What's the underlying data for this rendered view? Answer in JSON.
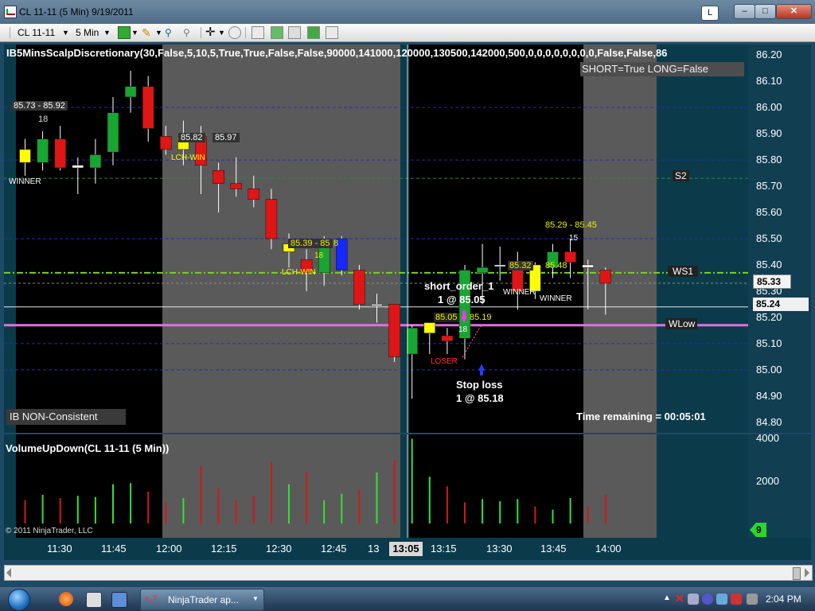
{
  "window": {
    "title": "CL 11-11 (5 Min)  9/19/2011",
    "l_button": "L",
    "min_glyph": "–",
    "max_glyph": "□",
    "close_glyph": "✕"
  },
  "toolbar": {
    "instrument": "CL 11-11",
    "interval": "5 Min"
  },
  "chart": {
    "indicator_header": "IB5MinsScalpDiscretionary(30,False,5,10,5,True,True,False,False,90000,141000,120000,130500,142000,500,0,0,0,0,0,0,0,0,False,False,86",
    "short_long_text": "SHORT=True LONG=False",
    "ib_text": "IB NON-Consistent",
    "time_remaining": "Time remaining = 00:05:01",
    "copyright": "© 2011 NinjaTrader, LLC",
    "volume_title": "VolumeUpDown(CL 11-11 (5 Min))",
    "price_labels": {
      "last": "85.33",
      "line": "85.24"
    },
    "level_labels": {
      "s2": "S2",
      "ws1": "WS1",
      "wlow": "WLow"
    },
    "annotations": {
      "range1": "85.73 - 85.92",
      "n1": "18",
      "winner1": "WINNER",
      "range2_a": "85.82",
      "range2_b": "85.97",
      "lch1": "LCH-WIN",
      "range3_a": "85.39 - 85",
      "range3_b": "8",
      "n3": "18",
      "lch2": "LCH-WIN",
      "short_order": "short_order_1",
      "short_price": "1 @ 85.05",
      "range4_a": "85.05",
      "range4_b": "85.19",
      "n4": "18",
      "loser": "LOSER",
      "stop_loss": "Stop loss",
      "stop_price": "1 @ 85.18",
      "range5_a": "85.32",
      "range5_b": "85.48",
      "winner2": "WINNER",
      "winner3": "WINNER",
      "range6": "85.29 - 85.45",
      "n6": "15"
    },
    "time_marker": "13:05",
    "volume_badge": "9"
  },
  "chart_data": {
    "type": "candlestick",
    "x_ticks": [
      "11:30",
      "11:45",
      "12:00",
      "12:15",
      "12:30",
      "12:45",
      "13",
      "13:15",
      "13:30",
      "13:45",
      "14:00"
    ],
    "y_ticks": [
      "86.20",
      "86.10",
      "86.00",
      "85.90",
      "85.80",
      "85.70",
      "85.60",
      "85.50",
      "85.40",
      "85.30",
      "85.20",
      "85.10",
      "85.00",
      "84.90",
      "84.80"
    ],
    "ylim": [
      84.76,
      86.24
    ],
    "volume_ticks": [
      "4000",
      "2000"
    ],
    "volume_ylim": [
      0,
      4200
    ],
    "candles": [
      {
        "o": 85.84,
        "h": 85.88,
        "l": 85.74,
        "c": 85.79,
        "color": "yellow"
      },
      {
        "o": 85.79,
        "h": 85.91,
        "l": 85.76,
        "c": 85.88,
        "color": "green"
      },
      {
        "o": 85.88,
        "h": 85.93,
        "l": 85.76,
        "c": 85.77,
        "color": "red"
      },
      {
        "o": 85.78,
        "h": 85.81,
        "l": 85.67,
        "c": 85.77,
        "color": "white"
      },
      {
        "o": 85.77,
        "h": 85.88,
        "l": 85.71,
        "c": 85.82,
        "color": "green"
      },
      {
        "o": 85.83,
        "h": 86.04,
        "l": 85.78,
        "c": 85.98,
        "color": "green"
      },
      {
        "o": 86.04,
        "h": 86.14,
        "l": 85.98,
        "c": 86.08,
        "color": "green"
      },
      {
        "o": 86.08,
        "h": 86.12,
        "l": 85.87,
        "c": 85.92,
        "color": "red"
      },
      {
        "o": 85.89,
        "h": 85.93,
        "l": 85.82,
        "c": 85.84,
        "color": "red"
      },
      {
        "o": 85.84,
        "h": 85.95,
        "l": 85.78,
        "c": 85.89,
        "color": "yellow"
      },
      {
        "o": 85.89,
        "h": 85.93,
        "l": 85.67,
        "c": 85.78,
        "color": "red"
      },
      {
        "o": 85.76,
        "h": 85.79,
        "l": 85.6,
        "c": 85.71,
        "color": "red"
      },
      {
        "o": 85.71,
        "h": 85.81,
        "l": 85.66,
        "c": 85.69,
        "color": "red"
      },
      {
        "o": 85.69,
        "h": 85.74,
        "l": 85.62,
        "c": 85.65,
        "color": "red"
      },
      {
        "o": 85.65,
        "h": 85.69,
        "l": 85.46,
        "c": 85.5,
        "color": "red"
      },
      {
        "o": 85.48,
        "h": 85.52,
        "l": 85.39,
        "c": 85.45,
        "color": "yellow"
      },
      {
        "o": 85.42,
        "h": 85.46,
        "l": 85.3,
        "c": 85.37,
        "color": "red"
      },
      {
        "o": 85.37,
        "h": 85.51,
        "l": 85.32,
        "c": 85.49,
        "color": "green"
      },
      {
        "o": 85.5,
        "h": 85.51,
        "l": 85.36,
        "c": 85.38,
        "color": "blue"
      },
      {
        "o": 85.38,
        "h": 85.4,
        "l": 85.23,
        "c": 85.25,
        "color": "red"
      },
      {
        "o": 85.25,
        "h": 85.29,
        "l": 85.18,
        "c": 85.25,
        "color": "white"
      },
      {
        "o": 85.25,
        "h": 85.25,
        "l": 85.03,
        "c": 85.05,
        "color": "red"
      },
      {
        "o": 85.06,
        "h": 85.17,
        "l": 84.89,
        "c": 85.16,
        "color": "green"
      },
      {
        "o": 85.14,
        "h": 85.18,
        "l": 85.06,
        "c": 85.18,
        "color": "yellow"
      },
      {
        "o": 85.13,
        "h": 85.16,
        "l": 85.06,
        "c": 85.11,
        "color": "red"
      },
      {
        "o": 85.12,
        "h": 85.4,
        "l": 85.04,
        "c": 85.38,
        "color": "green"
      },
      {
        "o": 85.37,
        "h": 85.48,
        "l": 85.25,
        "c": 85.39,
        "color": "green"
      },
      {
        "o": 85.4,
        "h": 85.47,
        "l": 85.34,
        "c": 85.4,
        "color": "white"
      },
      {
        "o": 85.41,
        "h": 85.45,
        "l": 85.23,
        "c": 85.3,
        "color": "red"
      },
      {
        "o": 85.3,
        "h": 85.41,
        "l": 85.27,
        "c": 85.4,
        "color": "yellow"
      },
      {
        "o": 85.39,
        "h": 85.48,
        "l": 85.35,
        "c": 85.45,
        "color": "green"
      },
      {
        "o": 85.45,
        "h": 85.5,
        "l": 85.35,
        "c": 85.41,
        "color": "red"
      },
      {
        "o": 85.4,
        "h": 85.42,
        "l": 85.23,
        "c": 85.39,
        "color": "white"
      },
      {
        "o": 85.38,
        "h": 85.39,
        "l": 85.21,
        "c": 85.33,
        "color": "red"
      }
    ],
    "volumes": [
      {
        "v": 1100,
        "d": "down"
      },
      {
        "v": 1350,
        "d": "up"
      },
      {
        "v": 1200,
        "d": "down"
      },
      {
        "v": 1300,
        "d": "up"
      },
      {
        "v": 1250,
        "d": "up"
      },
      {
        "v": 1850,
        "d": "up"
      },
      {
        "v": 1900,
        "d": "up"
      },
      {
        "v": 1500,
        "d": "down"
      },
      {
        "v": 1000,
        "d": "down"
      },
      {
        "v": 1200,
        "d": "up"
      },
      {
        "v": 2700,
        "d": "down"
      },
      {
        "v": 1650,
        "d": "down"
      },
      {
        "v": 1100,
        "d": "down"
      },
      {
        "v": 1300,
        "d": "down"
      },
      {
        "v": 2900,
        "d": "down"
      },
      {
        "v": 1850,
        "d": "up"
      },
      {
        "v": 2450,
        "d": "down"
      },
      {
        "v": 1100,
        "d": "up"
      },
      {
        "v": 1400,
        "d": "up"
      },
      {
        "v": 1600,
        "d": "down"
      },
      {
        "v": 2400,
        "d": "up"
      },
      {
        "v": 3000,
        "d": "down"
      },
      {
        "v": 4000,
        "d": "up"
      },
      {
        "v": 2200,
        "d": "up"
      },
      {
        "v": 1750,
        "d": "down"
      },
      {
        "v": 1000,
        "d": "down"
      },
      {
        "v": 1150,
        "d": "up"
      },
      {
        "v": 1050,
        "d": "up"
      },
      {
        "v": 1150,
        "d": "up"
      },
      {
        "v": 800,
        "d": "down"
      },
      {
        "v": 650,
        "d": "up"
      },
      {
        "v": 1200,
        "d": "up"
      },
      {
        "v": 800,
        "d": "down"
      },
      {
        "v": 1350,
        "d": "down"
      }
    ],
    "hlines": [
      {
        "price": 86.0,
        "style": "dashed-navy"
      },
      {
        "price": 85.8,
        "style": "dashed-navy"
      },
      {
        "price": 85.73,
        "style": "dashed-green"
      },
      {
        "price": 85.5,
        "style": "dashed-navy"
      },
      {
        "price": 85.37,
        "style": "dashdot-lime"
      },
      {
        "price": 85.33,
        "style": "dashed-gray"
      },
      {
        "price": 85.24,
        "style": "solid-white"
      },
      {
        "price": 85.17,
        "style": "solid-magenta"
      },
      {
        "price": 85.1,
        "style": "dashed-navy"
      },
      {
        "price": 85.0,
        "style": "dashed-navy"
      }
    ]
  },
  "taskbar": {
    "app_button": "NinjaTrader ap...",
    "clock": "2:04 PM"
  },
  "colors": {
    "up": "#18a532",
    "down": "#e01515",
    "neutral": "#ffff00",
    "blue": "#1428ff",
    "vol_up": "#35e035",
    "vol_down": "#d21818",
    "session_dark": "#000000",
    "session_gray": "#5a5a5a"
  }
}
